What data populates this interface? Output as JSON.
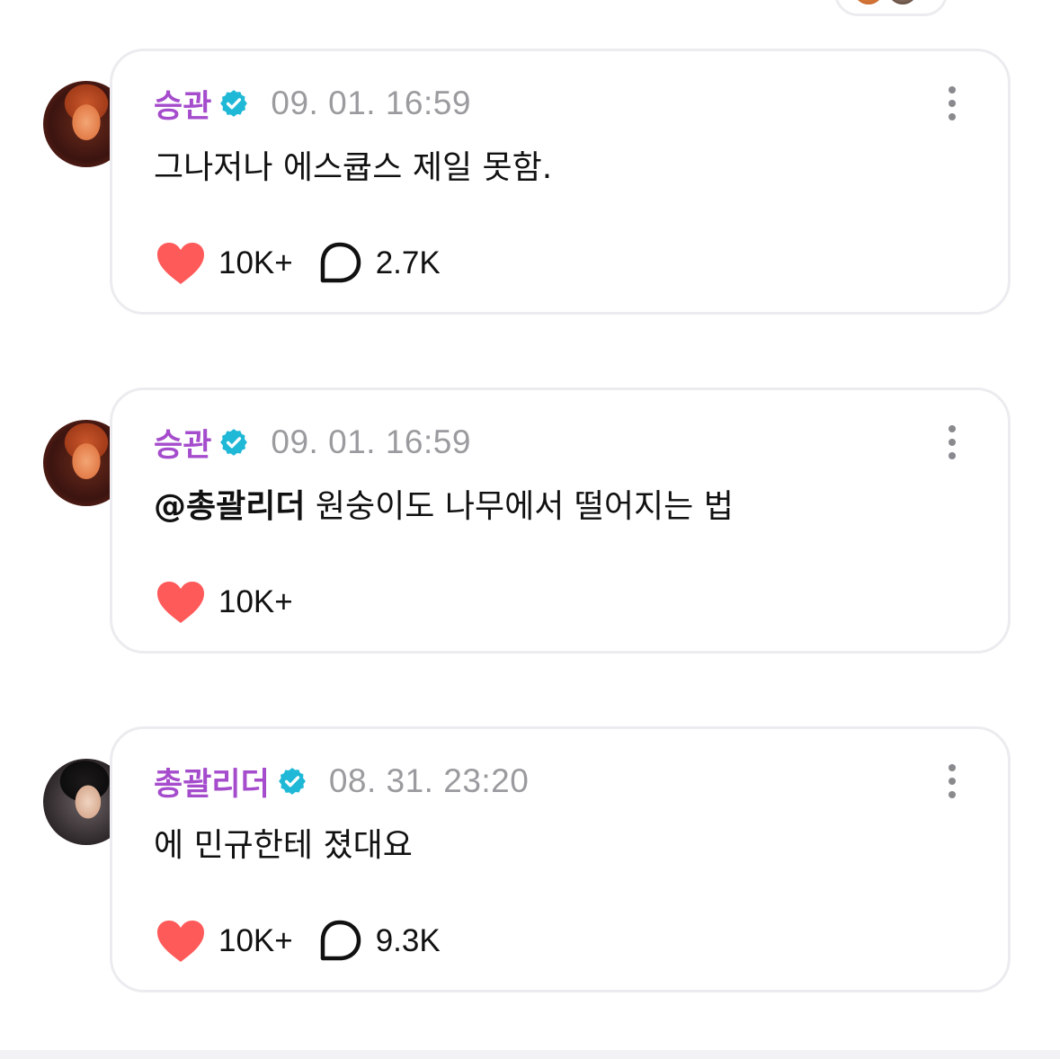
{
  "posts": [
    {
      "author": "승관",
      "timestamp": "09. 01. 16:59",
      "mention": "",
      "text": "그나저나 에스큡스 제일 못함.",
      "likes": "10K+",
      "comments": "2.7K"
    },
    {
      "author": "승관",
      "timestamp": "09. 01. 16:59",
      "mention": "@총괄리더",
      "text": " 원숭이도 나무에서 떨어지는 법",
      "likes": "10K+",
      "comments": ""
    },
    {
      "author": "총괄리더",
      "timestamp": "08. 31. 23:20",
      "mention": "",
      "text": "에 민규한테 졌대요",
      "likes": "10K+",
      "comments": "9.3K"
    }
  ],
  "colors": {
    "author": "#a54ccd",
    "verified": "#1fb8d6",
    "heart": "#ff5a5a",
    "timestamp": "#9b9b9f"
  }
}
